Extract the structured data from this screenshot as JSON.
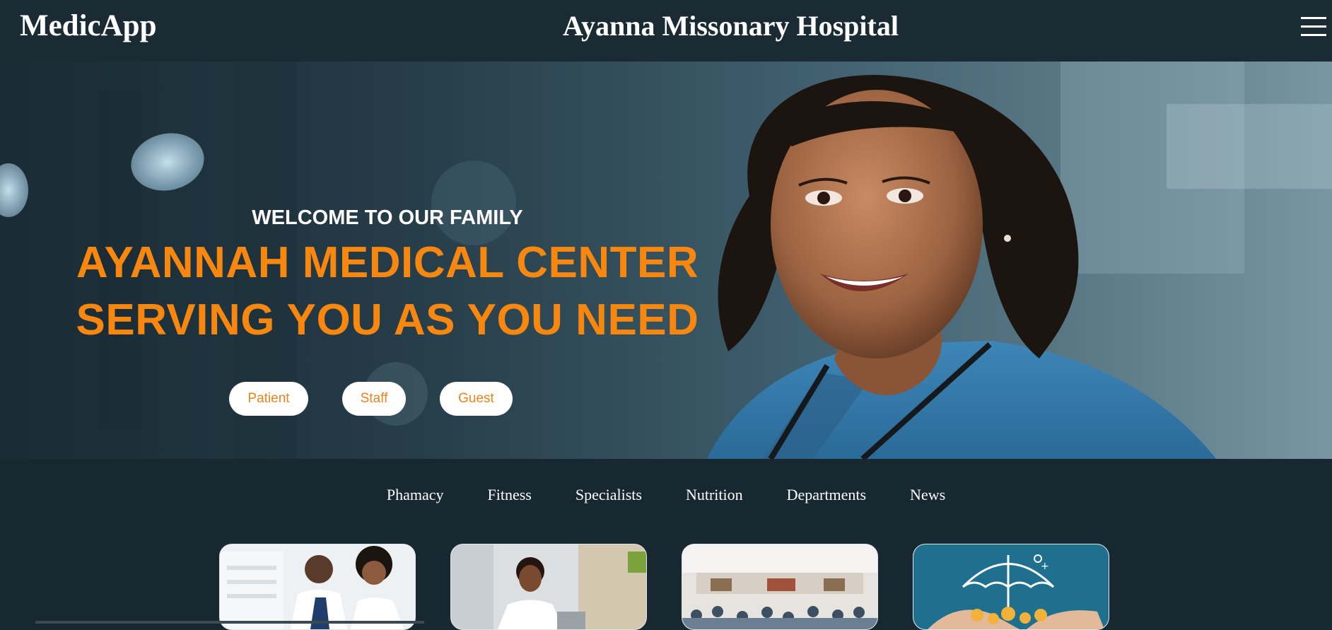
{
  "header": {
    "brand": "MedicApp",
    "title": "Ayanna Missonary Hospital",
    "menu_icon": "hamburger-menu-icon"
  },
  "hero": {
    "welcome": "WELCOME TO OUR FAMILY",
    "headline_line1": "AYANNAH MEDICAL CENTER",
    "headline_line2": "SERVING YOU AS YOU NEED",
    "buttons": {
      "patient": "Patient",
      "staff": "Staff",
      "guest": "Guest"
    }
  },
  "categories": [
    "Phamacy",
    "Fitness",
    "Specialists",
    "Nutrition",
    "Departments",
    "News"
  ],
  "colors": {
    "background": "#182830",
    "header": "#1b2b33",
    "accent_orange": "#f7870e",
    "button_text": "#e8831d",
    "white": "#ffffff"
  }
}
